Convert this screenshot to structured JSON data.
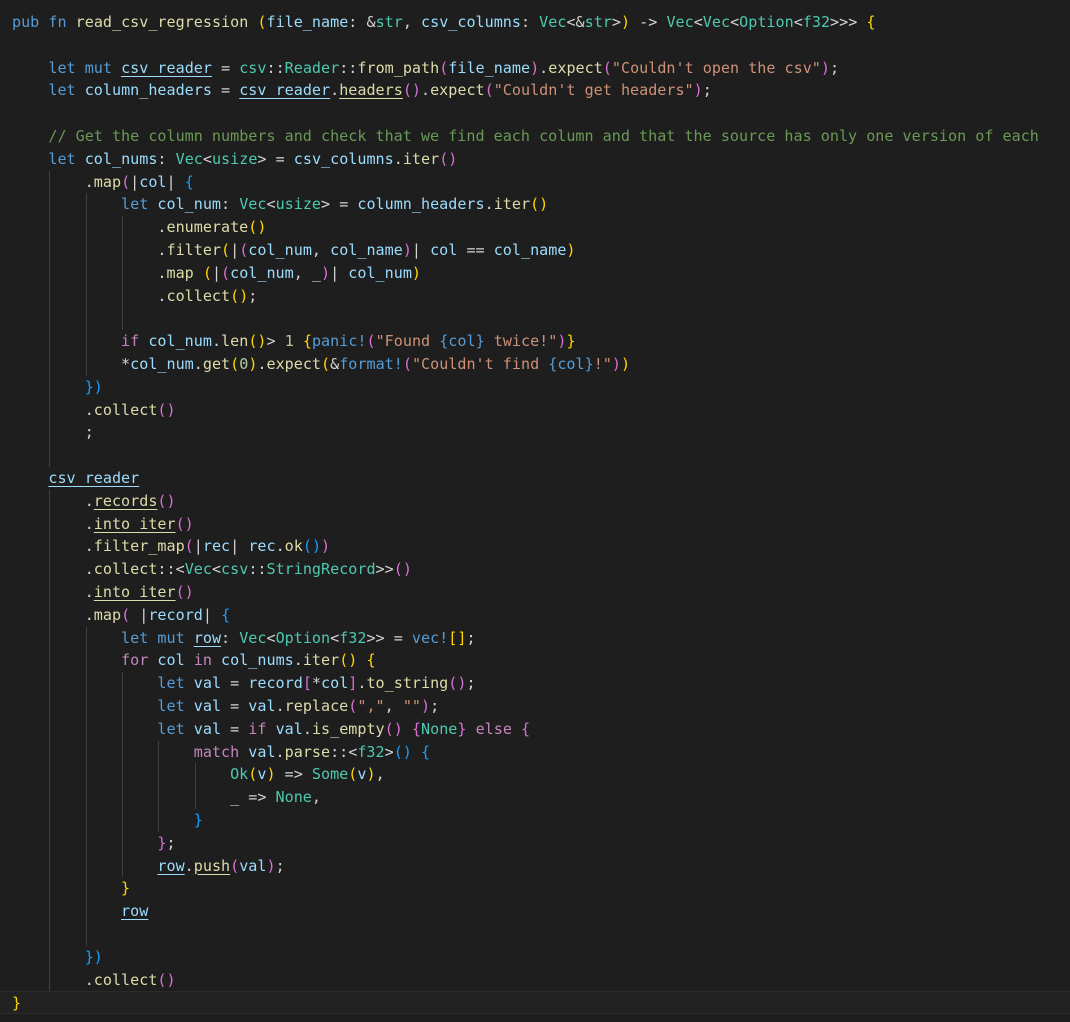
{
  "editor": {
    "language": "rust",
    "colors": {
      "background": "#1e1e1e",
      "keyword": "#569cd6",
      "control": "#c586c0",
      "function": "#dcdcaa",
      "type": "#4ec9b0",
      "variable": "#9cdcfe",
      "string": "#ce9178",
      "number": "#b5cea8",
      "comment": "#6a9955",
      "bracket_1": "#ffd700",
      "bracket_2": "#da70d6",
      "bracket_3": "#179fff"
    },
    "lines": [
      [
        [
          "kw",
          "pub"
        ],
        [
          "p",
          " "
        ],
        [
          "kw",
          "fn"
        ],
        [
          "p",
          " "
        ],
        [
          "fn",
          "read_csv_regression"
        ],
        [
          "p",
          " "
        ],
        [
          "b1",
          "("
        ],
        [
          "var",
          "file_name"
        ],
        [
          "p",
          ": &"
        ],
        [
          "ty",
          "str"
        ],
        [
          "p",
          ", "
        ],
        [
          "var",
          "csv_columns"
        ],
        [
          "p",
          ": "
        ],
        [
          "ty",
          "Vec"
        ],
        [
          "p",
          "<&"
        ],
        [
          "ty",
          "str"
        ],
        [
          "p",
          ">"
        ],
        [
          "b1",
          ")"
        ],
        [
          "p",
          " -> "
        ],
        [
          "ty",
          "Vec"
        ],
        [
          "p",
          "<"
        ],
        [
          "ty",
          "Vec"
        ],
        [
          "p",
          "<"
        ],
        [
          "ty",
          "Option"
        ],
        [
          "p",
          "<"
        ],
        [
          "ty",
          "f32"
        ],
        [
          "p",
          ">>> "
        ],
        [
          "b1",
          "{"
        ]
      ],
      [],
      [
        [
          "p",
          "    "
        ],
        [
          "kw",
          "let"
        ],
        [
          "p",
          " "
        ],
        [
          "kw",
          "mut"
        ],
        [
          "p",
          " "
        ],
        [
          "var",
          "csv_reader",
          "u"
        ],
        [
          "p",
          " = "
        ],
        [
          "ty",
          "csv"
        ],
        [
          "p",
          "::"
        ],
        [
          "ty",
          "Reader"
        ],
        [
          "p",
          "::"
        ],
        [
          "fn",
          "from_path"
        ],
        [
          "b2",
          "("
        ],
        [
          "var",
          "file_name"
        ],
        [
          "b2",
          ")"
        ],
        [
          "p",
          "."
        ],
        [
          "fn",
          "expect"
        ],
        [
          "b2",
          "("
        ],
        [
          "str",
          "\"Couldn't open the csv\""
        ],
        [
          "b2",
          ")"
        ],
        [
          "p",
          ";"
        ]
      ],
      [
        [
          "p",
          "    "
        ],
        [
          "kw",
          "let"
        ],
        [
          "p",
          " "
        ],
        [
          "var",
          "column_headers"
        ],
        [
          "p",
          " = "
        ],
        [
          "var",
          "csv_reader",
          "u"
        ],
        [
          "p",
          "."
        ],
        [
          "fn",
          "headers",
          "u"
        ],
        [
          "b2",
          "()"
        ],
        [
          "p",
          "."
        ],
        [
          "fn",
          "expect"
        ],
        [
          "b2",
          "("
        ],
        [
          "str",
          "\"Couldn't get headers\""
        ],
        [
          "b2",
          ")"
        ],
        [
          "p",
          ";"
        ]
      ],
      [],
      [
        [
          "p",
          "    "
        ],
        [
          "cm",
          "// Get the column numbers and check that we find each column and that the source has only one version of each"
        ]
      ],
      [
        [
          "p",
          "    "
        ],
        [
          "kw",
          "let"
        ],
        [
          "p",
          " "
        ],
        [
          "var",
          "col_nums"
        ],
        [
          "p",
          ": "
        ],
        [
          "ty",
          "Vec"
        ],
        [
          "p",
          "<"
        ],
        [
          "ty",
          "usize"
        ],
        [
          "p",
          "> = "
        ],
        [
          "var",
          "csv_columns"
        ],
        [
          "p",
          "."
        ],
        [
          "fn",
          "iter"
        ],
        [
          "b2",
          "()"
        ]
      ],
      [
        [
          "p",
          "        ."
        ],
        [
          "fn",
          "map"
        ],
        [
          "b2",
          "("
        ],
        [
          "p",
          "|"
        ],
        [
          "var",
          "col"
        ],
        [
          "p",
          "| "
        ],
        [
          "b3",
          "{"
        ]
      ],
      [
        [
          "p",
          "            "
        ],
        [
          "kw",
          "let"
        ],
        [
          "p",
          " "
        ],
        [
          "var",
          "col_num"
        ],
        [
          "p",
          ": "
        ],
        [
          "ty",
          "Vec"
        ],
        [
          "p",
          "<"
        ],
        [
          "ty",
          "usize"
        ],
        [
          "p",
          "> = "
        ],
        [
          "var",
          "column_headers"
        ],
        [
          "p",
          "."
        ],
        [
          "fn",
          "iter"
        ],
        [
          "b1",
          "()"
        ]
      ],
      [
        [
          "p",
          "                ."
        ],
        [
          "fn",
          "enumerate"
        ],
        [
          "b1",
          "()"
        ]
      ],
      [
        [
          "p",
          "                ."
        ],
        [
          "fn",
          "filter"
        ],
        [
          "b1",
          "("
        ],
        [
          "p",
          "|"
        ],
        [
          "b2",
          "("
        ],
        [
          "var",
          "col_num"
        ],
        [
          "p",
          ", "
        ],
        [
          "var",
          "col_name"
        ],
        [
          "b2",
          ")"
        ],
        [
          "p",
          "| "
        ],
        [
          "var",
          "col"
        ],
        [
          "p",
          " == "
        ],
        [
          "var",
          "col_name"
        ],
        [
          "b1",
          ")"
        ]
      ],
      [
        [
          "p",
          "                ."
        ],
        [
          "fn",
          "map"
        ],
        [
          "p",
          " "
        ],
        [
          "b1",
          "("
        ],
        [
          "p",
          "|"
        ],
        [
          "b2",
          "("
        ],
        [
          "var",
          "col_num"
        ],
        [
          "p",
          ", _"
        ],
        [
          "b2",
          ")"
        ],
        [
          "p",
          "| "
        ],
        [
          "var",
          "col_num"
        ],
        [
          "b1",
          ")"
        ]
      ],
      [
        [
          "p",
          "                ."
        ],
        [
          "fn",
          "collect"
        ],
        [
          "b1",
          "()"
        ],
        [
          "p",
          ";"
        ]
      ],
      [],
      [
        [
          "p",
          "            "
        ],
        [
          "ctl",
          "if"
        ],
        [
          "p",
          " "
        ],
        [
          "var",
          "col_num"
        ],
        [
          "p",
          "."
        ],
        [
          "fn",
          "len"
        ],
        [
          "b1",
          "()"
        ],
        [
          "p",
          "> "
        ],
        [
          "num",
          "1"
        ],
        [
          "p",
          " "
        ],
        [
          "b1",
          "{"
        ],
        [
          "kw",
          "panic!"
        ],
        [
          "b2",
          "("
        ],
        [
          "str",
          "\"Found "
        ],
        [
          "kw",
          "{col}"
        ],
        [
          "str",
          " twice!\""
        ],
        [
          "b2",
          ")"
        ],
        [
          "b1",
          "}"
        ]
      ],
      [
        [
          "p",
          "            *"
        ],
        [
          "var",
          "col_num"
        ],
        [
          "p",
          "."
        ],
        [
          "fn",
          "get"
        ],
        [
          "b1",
          "("
        ],
        [
          "num",
          "0"
        ],
        [
          "b1",
          ")"
        ],
        [
          "p",
          "."
        ],
        [
          "fn",
          "expect"
        ],
        [
          "b1",
          "("
        ],
        [
          "p",
          "&"
        ],
        [
          "kw",
          "format!"
        ],
        [
          "b2",
          "("
        ],
        [
          "str",
          "\"Couldn't find "
        ],
        [
          "kw",
          "{col}"
        ],
        [
          "str",
          "!\""
        ],
        [
          "b2",
          ")"
        ],
        [
          "b1",
          ")"
        ]
      ],
      [
        [
          "p",
          "        "
        ],
        [
          "b3",
          "})"
        ]
      ],
      [
        [
          "p",
          "        ."
        ],
        [
          "fn",
          "collect"
        ],
        [
          "b2",
          "()"
        ]
      ],
      [
        [
          "p",
          "        ;"
        ]
      ],
      [],
      [
        [
          "p",
          "    "
        ],
        [
          "var",
          "csv_reader",
          "u"
        ]
      ],
      [
        [
          "p",
          "        ."
        ],
        [
          "fn",
          "records",
          "u"
        ],
        [
          "b2",
          "()"
        ]
      ],
      [
        [
          "p",
          "        ."
        ],
        [
          "fn",
          "into_iter",
          "u"
        ],
        [
          "b2",
          "()"
        ]
      ],
      [
        [
          "p",
          "        ."
        ],
        [
          "fn",
          "filter_map"
        ],
        [
          "b2",
          "("
        ],
        [
          "p",
          "|"
        ],
        [
          "var",
          "rec"
        ],
        [
          "p",
          "| "
        ],
        [
          "var",
          "rec"
        ],
        [
          "p",
          "."
        ],
        [
          "fn",
          "ok"
        ],
        [
          "b3",
          "()"
        ],
        [
          "b2",
          ")"
        ]
      ],
      [
        [
          "p",
          "        ."
        ],
        [
          "fn",
          "collect"
        ],
        [
          "p",
          "::<"
        ],
        [
          "ty",
          "Vec"
        ],
        [
          "p",
          "<"
        ],
        [
          "ty",
          "csv"
        ],
        [
          "p",
          "::"
        ],
        [
          "ty",
          "StringRecord"
        ],
        [
          "p",
          ">>"
        ],
        [
          "b2",
          "()"
        ]
      ],
      [
        [
          "p",
          "        ."
        ],
        [
          "fn",
          "into_iter",
          "u"
        ],
        [
          "b2",
          "()"
        ]
      ],
      [
        [
          "p",
          "        ."
        ],
        [
          "fn",
          "map"
        ],
        [
          "b2",
          "("
        ],
        [
          "p",
          " |"
        ],
        [
          "var",
          "record"
        ],
        [
          "p",
          "| "
        ],
        [
          "b3",
          "{"
        ]
      ],
      [
        [
          "p",
          "            "
        ],
        [
          "kw",
          "let"
        ],
        [
          "p",
          " "
        ],
        [
          "kw",
          "mut"
        ],
        [
          "p",
          " "
        ],
        [
          "var",
          "row",
          "u"
        ],
        [
          "p",
          ": "
        ],
        [
          "ty",
          "Vec"
        ],
        [
          "p",
          "<"
        ],
        [
          "ty",
          "Option"
        ],
        [
          "p",
          "<"
        ],
        [
          "ty",
          "f32"
        ],
        [
          "p",
          ">> = "
        ],
        [
          "kw",
          "vec!"
        ],
        [
          "b1",
          "[]"
        ],
        [
          "p",
          ";"
        ]
      ],
      [
        [
          "p",
          "            "
        ],
        [
          "ctl",
          "for"
        ],
        [
          "p",
          " "
        ],
        [
          "var",
          "col"
        ],
        [
          "p",
          " "
        ],
        [
          "ctl",
          "in"
        ],
        [
          "p",
          " "
        ],
        [
          "var",
          "col_nums"
        ],
        [
          "p",
          "."
        ],
        [
          "fn",
          "iter"
        ],
        [
          "b1",
          "()"
        ],
        [
          "p",
          " "
        ],
        [
          "b1",
          "{"
        ]
      ],
      [
        [
          "p",
          "                "
        ],
        [
          "kw",
          "let"
        ],
        [
          "p",
          " "
        ],
        [
          "var",
          "val"
        ],
        [
          "p",
          " = "
        ],
        [
          "var",
          "record"
        ],
        [
          "b2",
          "["
        ],
        [
          "p",
          "*"
        ],
        [
          "var",
          "col"
        ],
        [
          "b2",
          "]"
        ],
        [
          "p",
          "."
        ],
        [
          "fn",
          "to_string"
        ],
        [
          "b2",
          "()"
        ],
        [
          "p",
          ";"
        ]
      ],
      [
        [
          "p",
          "                "
        ],
        [
          "kw",
          "let"
        ],
        [
          "p",
          " "
        ],
        [
          "var",
          "val"
        ],
        [
          "p",
          " = "
        ],
        [
          "var",
          "val"
        ],
        [
          "p",
          "."
        ],
        [
          "fn",
          "replace"
        ],
        [
          "b2",
          "("
        ],
        [
          "str",
          "\",\""
        ],
        [
          "p",
          ", "
        ],
        [
          "str",
          "\"\""
        ],
        [
          "b2",
          ")"
        ],
        [
          "p",
          ";"
        ]
      ],
      [
        [
          "p",
          "                "
        ],
        [
          "kw",
          "let"
        ],
        [
          "p",
          " "
        ],
        [
          "var",
          "val"
        ],
        [
          "p",
          " = "
        ],
        [
          "ctl",
          "if"
        ],
        [
          "p",
          " "
        ],
        [
          "var",
          "val"
        ],
        [
          "p",
          "."
        ],
        [
          "fn",
          "is_empty"
        ],
        [
          "b2",
          "()"
        ],
        [
          "p",
          " "
        ],
        [
          "b2",
          "{"
        ],
        [
          "ty",
          "None"
        ],
        [
          "b2",
          "}"
        ],
        [
          "p",
          " "
        ],
        [
          "ctl",
          "else"
        ],
        [
          "p",
          " "
        ],
        [
          "b2",
          "{"
        ]
      ],
      [
        [
          "p",
          "                    "
        ],
        [
          "ctl",
          "match"
        ],
        [
          "p",
          " "
        ],
        [
          "var",
          "val"
        ],
        [
          "p",
          "."
        ],
        [
          "fn",
          "parse"
        ],
        [
          "p",
          "::<"
        ],
        [
          "ty",
          "f32"
        ],
        [
          "p",
          ">"
        ],
        [
          "b3",
          "()"
        ],
        [
          "p",
          " "
        ],
        [
          "b3",
          "{"
        ]
      ],
      [
        [
          "p",
          "                        "
        ],
        [
          "ty",
          "Ok"
        ],
        [
          "b1",
          "("
        ],
        [
          "var",
          "v"
        ],
        [
          "b1",
          ")"
        ],
        [
          "p",
          " => "
        ],
        [
          "ty",
          "Some"
        ],
        [
          "b1",
          "("
        ],
        [
          "var",
          "v"
        ],
        [
          "b1",
          ")"
        ],
        [
          "p",
          ","
        ]
      ],
      [
        [
          "p",
          "                        _ => "
        ],
        [
          "ty",
          "None"
        ],
        [
          "p",
          ","
        ]
      ],
      [
        [
          "p",
          "                    "
        ],
        [
          "b3",
          "}"
        ]
      ],
      [
        [
          "p",
          "                "
        ],
        [
          "b2",
          "}"
        ],
        [
          "p",
          ";"
        ]
      ],
      [
        [
          "p",
          "                "
        ],
        [
          "var",
          "row",
          "u"
        ],
        [
          "p",
          "."
        ],
        [
          "fn",
          "push",
          "u"
        ],
        [
          "b2",
          "("
        ],
        [
          "var",
          "val"
        ],
        [
          "b2",
          ")"
        ],
        [
          "p",
          ";"
        ]
      ],
      [
        [
          "p",
          "            "
        ],
        [
          "b1",
          "}"
        ]
      ],
      [
        [
          "p",
          "            "
        ],
        [
          "var",
          "row",
          "u"
        ]
      ],
      [],
      [
        [
          "p",
          "        "
        ],
        [
          "b3",
          "})"
        ]
      ],
      [
        [
          "p",
          "        ."
        ],
        [
          "fn",
          "collect"
        ],
        [
          "b2",
          "()"
        ]
      ],
      [
        [
          "b1",
          "}"
        ]
      ]
    ]
  }
}
